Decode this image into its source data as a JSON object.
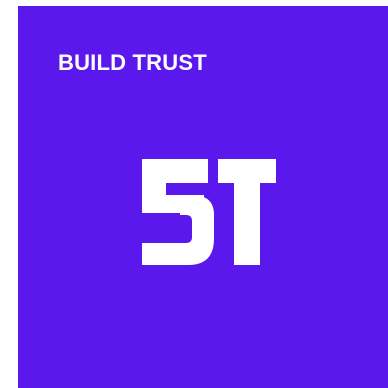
{
  "brand": {
    "name": "BUILD TRUST",
    "logo_letters": "BT",
    "logo_icon": "bt-monogram-logo"
  },
  "colors": {
    "background": "#5b18ec",
    "foreground": "#ffffff"
  }
}
